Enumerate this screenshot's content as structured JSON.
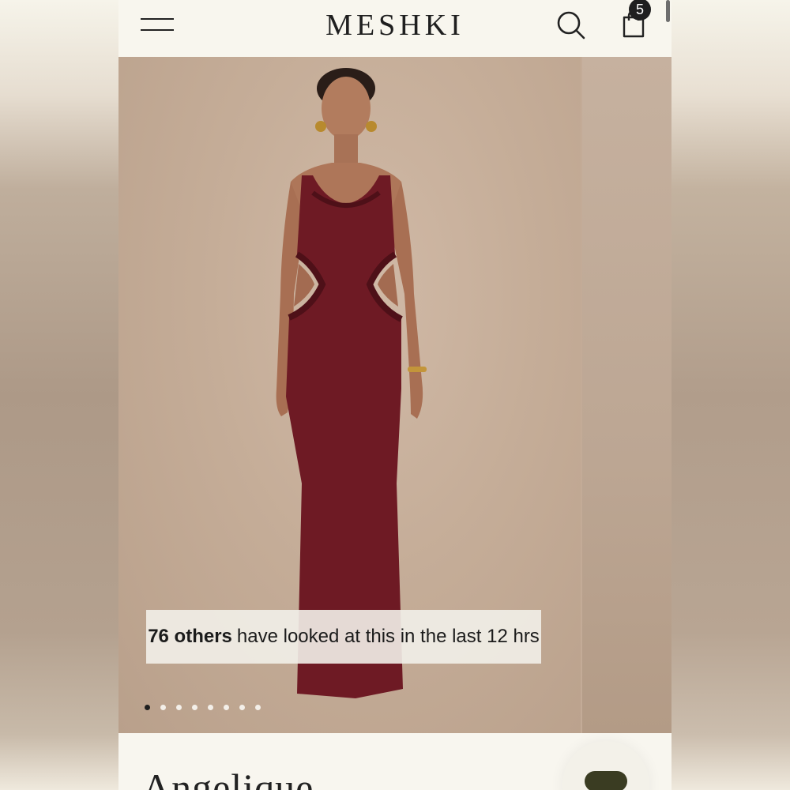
{
  "header": {
    "brand": "MESHKI",
    "cart_count": "5",
    "icons": {
      "menu": "menu-icon",
      "search": "search-icon",
      "bag": "shopping-bag-icon"
    }
  },
  "gallery": {
    "social_proof": {
      "count": "76 others",
      "text": "have looked at this in the last 12 hrs"
    },
    "slide_count": 8,
    "active_slide": 1
  },
  "product": {
    "title": "Angelique"
  },
  "colors": {
    "dress": "#6e1a24",
    "background": "#c3ab97",
    "accent_button": "#3a3c22"
  }
}
